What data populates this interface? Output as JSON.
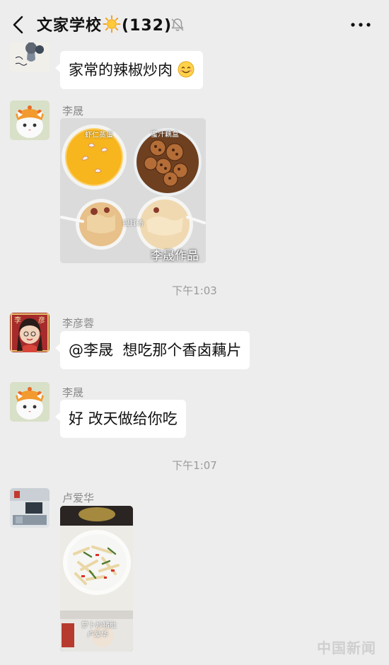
{
  "header": {
    "title": "文家学校",
    "member_count": "(132)",
    "title_icon": "sun-icon",
    "mute_icon": "bell-off-icon",
    "more_icon": "more-dots-icon",
    "back_icon": "chevron-left-icon"
  },
  "messages": [
    {
      "type": "text",
      "text": "家常的辣椒炒肉",
      "emoji": "smiling-face-icon"
    },
    {
      "type": "image",
      "sender": "李晟",
      "caption": "李晟作品",
      "photo_labels": [
        "虾仁蒸蛋",
        "蜜汁藕盒",
        "银耳汤"
      ]
    },
    {
      "type": "time",
      "text": "下午1:03"
    },
    {
      "type": "text",
      "sender": "李彦蓉",
      "text": "@李晟  想吃那个香卤藕片"
    },
    {
      "type": "text",
      "sender": "李晟",
      "text": "好 改天做给你吃"
    },
    {
      "type": "time",
      "text": "下午1:07"
    },
    {
      "type": "image",
      "sender": "卢爱华",
      "photo_labels": [
        "萝卜炒猪肚",
        "卢爱华"
      ]
    }
  ],
  "watermark": {
    "text": "中国新闻"
  }
}
